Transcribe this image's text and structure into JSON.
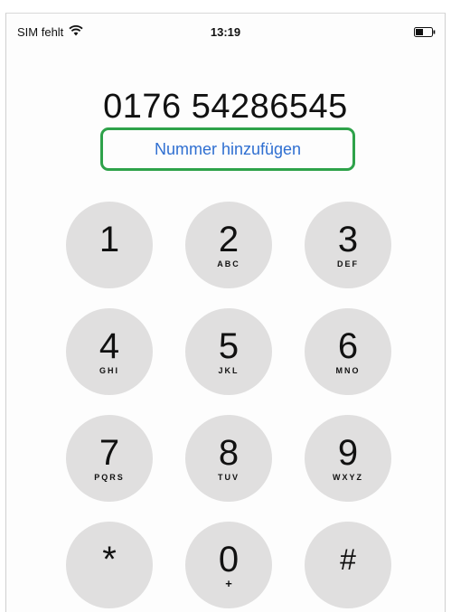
{
  "status": {
    "carrier": "SIM fehlt",
    "time": "13:19",
    "wifi_icon": "wifi-icon",
    "battery_icon": "battery-icon"
  },
  "dialer": {
    "number": "0176 54286545",
    "add_number_label": "Nummer hinzufügen"
  },
  "keys": [
    {
      "digit": "1",
      "letters": ""
    },
    {
      "digit": "2",
      "letters": "ABC"
    },
    {
      "digit": "3",
      "letters": "DEF"
    },
    {
      "digit": "4",
      "letters": "GHI"
    },
    {
      "digit": "5",
      "letters": "JKL"
    },
    {
      "digit": "6",
      "letters": "MNO"
    },
    {
      "digit": "7",
      "letters": "PQRS"
    },
    {
      "digit": "8",
      "letters": "TUV"
    },
    {
      "digit": "9",
      "letters": "WXYZ"
    },
    {
      "digit": "*",
      "letters": ""
    },
    {
      "digit": "0",
      "letters": "+"
    },
    {
      "digit": "#",
      "letters": ""
    }
  ],
  "colors": {
    "key_background": "#e0dfdf",
    "link_blue": "#2f6fd1",
    "highlight_green": "#2ea24a"
  }
}
